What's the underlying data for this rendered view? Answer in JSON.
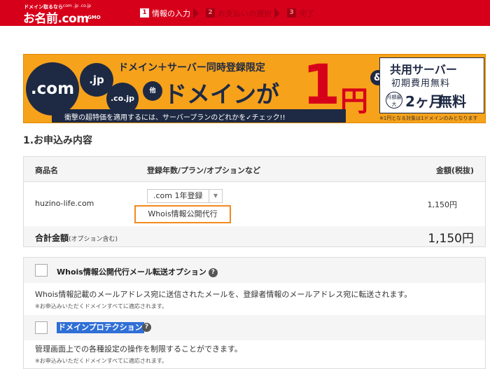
{
  "header": {
    "logo_tagline": "ドメイン取るなら",
    "logo_dots": ".com .jp .co.jp",
    "logo_text": "お名前.com",
    "logo_brand": "GMO",
    "steps": [
      {
        "num": "1",
        "label": "情報の入力"
      },
      {
        "num": "2",
        "label": "お支払いの選択"
      },
      {
        "num": "3",
        "label": "完了"
      }
    ]
  },
  "banner": {
    "tld_com": ".com",
    "tld_jp": ".jp",
    "tld_cojp": ".co.jp",
    "tld_other": "他",
    "headline": "ドメイン＋サーバー同時登録限定",
    "domain_ga": "ドメインが",
    "price_num": "1",
    "price_unit": "円",
    "sub_text": "衝撃の超特価を適用するには、サーバープランのどれかを✓チェック!!",
    "amp": "&",
    "server_title": "共用サーバー",
    "server_initial": "初期費用無料",
    "badge_text": "月額最大",
    "months": "2ヶ月",
    "free": "無料",
    "note": "※1円となる対象は1ドメインのみとなります"
  },
  "section": {
    "title": "1.お申込み内容"
  },
  "table": {
    "headers": {
      "product": "商品名",
      "plan": "登録年数/プラン/オプションなど",
      "price": "金額(税抜)"
    },
    "row": {
      "domain": "huzino-life.com",
      "select_value": ".com 1年登録",
      "option": "Whois情報公開代行",
      "price": "1,150円"
    },
    "total": {
      "label": "合計金額",
      "label_note": "(オプション含む)",
      "value": "1,150円"
    }
  },
  "options": [
    {
      "title": "Whois情報公開代行メール転送オプション",
      "help": "?",
      "desc": "Whois情報記載のメールアドレス宛に送信されたメールを、登録者情報のメールアドレス宛に転送されます。",
      "note": "※お申込みいただくドメインすべてに適応されます。"
    },
    {
      "title": "ドメインプロテクション",
      "help": "?",
      "desc": "管理画面上での各種設定の操作を制限することができます。",
      "note": "※お申込みいただくドメインすべてに適応されます。"
    }
  ]
}
